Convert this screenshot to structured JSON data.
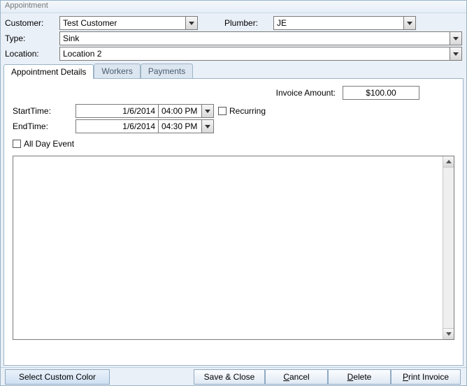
{
  "window": {
    "title": "Appointment"
  },
  "form": {
    "customer_label": "Customer:",
    "customer_value": "Test Customer",
    "plumber_label": "Plumber:",
    "plumber_value": "JE",
    "type_label": "Type:",
    "type_value": "Sink",
    "location_label": "Location:",
    "location_value": "Location 2"
  },
  "tabs": {
    "details": "Appointment Details",
    "workers": "Workers",
    "payments": "Payments",
    "active": "details"
  },
  "details": {
    "invoice_label": "Invoice Amount:",
    "invoice_value": "$100.00",
    "start_label": "StartTime:",
    "start_date": "1/6/2014",
    "start_time": "04:00 PM",
    "end_label": "EndTime:",
    "end_date": "1/6/2014",
    "end_time": "04:30 PM",
    "recurring_label": "Recurring",
    "recurring_checked": false,
    "allday_label": "All Day Event",
    "allday_checked": false,
    "notes": ""
  },
  "buttons": {
    "custom_color": "Select Custom Color",
    "save_close": "Save & Close",
    "cancel_pre": "",
    "cancel_mn": "C",
    "cancel_post": "ancel",
    "delete_pre": "",
    "delete_mn": "D",
    "delete_post": "elete",
    "print_pre": "",
    "print_mn": "P",
    "print_post": "rint Invoice"
  }
}
